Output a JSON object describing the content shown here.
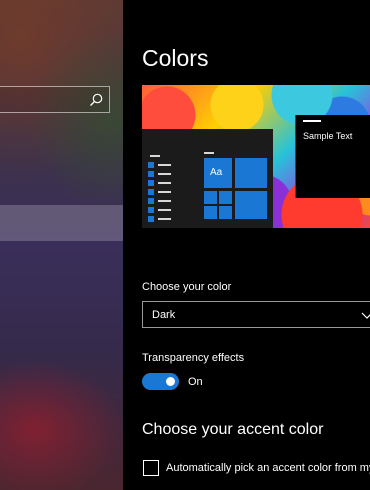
{
  "page": {
    "title": "Colors"
  },
  "preview": {
    "tile_label": "Aa",
    "sample_text": "Sample Text"
  },
  "color_mode": {
    "label": "Choose your color",
    "selected": "Dark"
  },
  "transparency": {
    "label": "Transparency effects",
    "state": "On",
    "enabled": true
  },
  "accent": {
    "title": "Choose your accent color",
    "auto_pick_label": "Automatically pick an accent color from my background",
    "auto_pick_checked": false,
    "accent_color": "#1a78d4"
  },
  "icons": {
    "search": "search-icon",
    "dropdown": "chevron-down-icon"
  }
}
